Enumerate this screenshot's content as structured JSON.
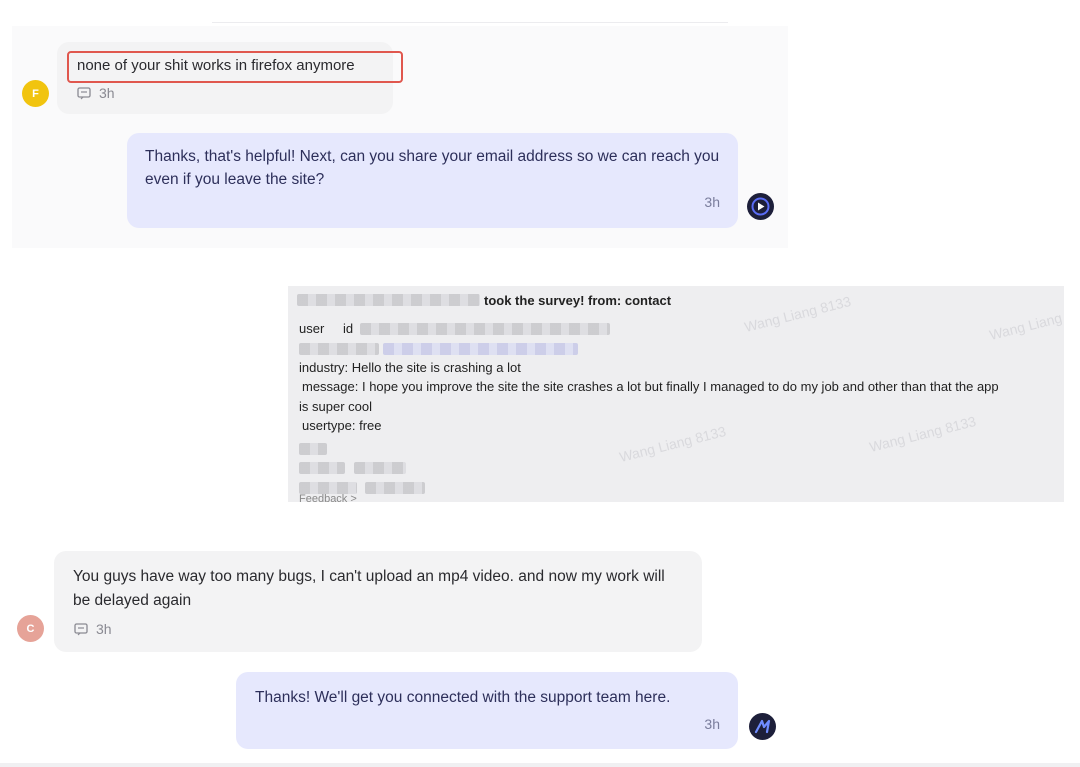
{
  "conversation": [
    {
      "author_initial": "F",
      "text": "none of your shit works in firefox anymore",
      "time": "3h"
    },
    {
      "text": "Thanks, that's helpful! Next, can you share your email address so we can reach you even if you leave the site?",
      "time": "3h"
    },
    {
      "author_initial": "C",
      "text": "You guys have way too many bugs, I can't upload an mp4 video. and now my work will be delayed again",
      "time": "3h"
    },
    {
      "text": "Thanks! We'll get you connected with the support team here.",
      "time": "3h"
    }
  ],
  "survey": {
    "header": "took the survey! from: contact",
    "user_label": "user",
    "id_label": "id",
    "industry": "industry: Hello the site is crashing a lot",
    "message": "message: I hope you improve the site the site crashes a lot but finally I managed to do my job and other than that the app",
    "message_cont": "is super cool",
    "usertype": "usertype: free",
    "footer": "Feedback >",
    "watermark": "Wang Liang 8133"
  },
  "icons": {
    "comment": "comment-icon",
    "bot": "bot-avatar-icon"
  },
  "colors": {
    "user_bubble": "#f3f3f4",
    "bot_bubble": "#e6e8fd",
    "highlight_border": "#e0574e",
    "avatar_f": "#f1c40f",
    "avatar_c": "#e6a398"
  }
}
